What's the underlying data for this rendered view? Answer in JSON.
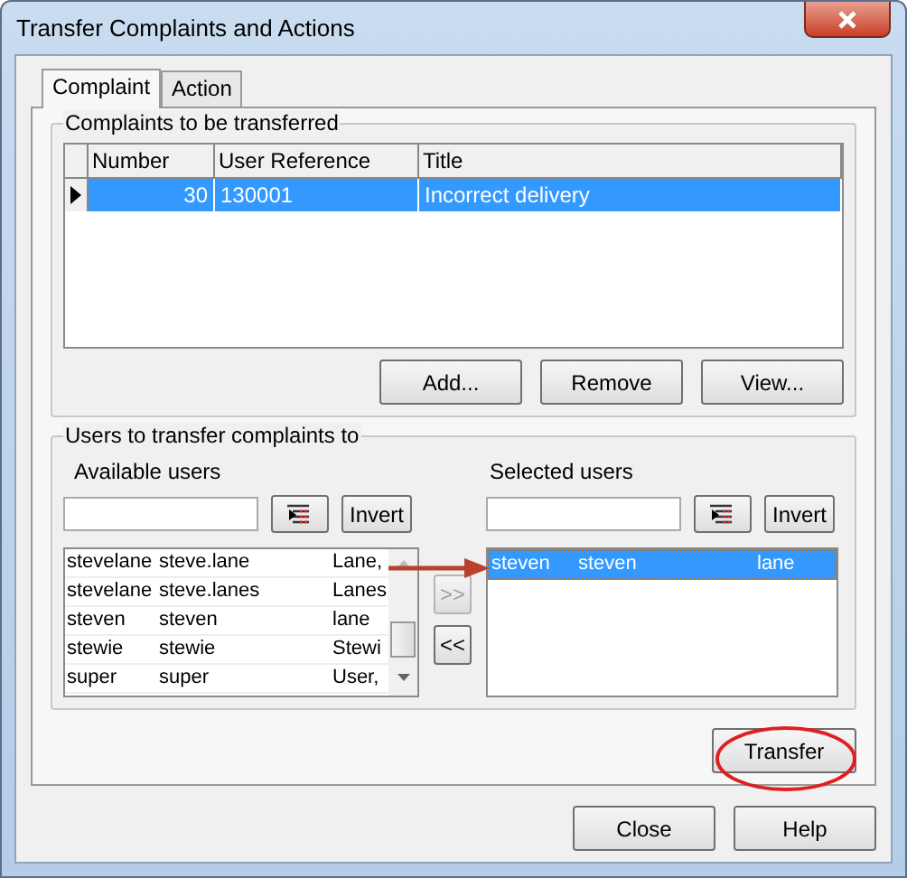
{
  "window": {
    "title": "Transfer Complaints and Actions"
  },
  "tabs": [
    {
      "label": "Complaint",
      "selected": true
    },
    {
      "label": "Action",
      "selected": false
    }
  ],
  "complaints": {
    "title": "Complaints to be transferred",
    "columns": [
      "Number",
      "User Reference",
      "Title"
    ],
    "rows": [
      {
        "number": "30",
        "user_reference": "130001",
        "title": "Incorrect delivery",
        "selected": true
      }
    ],
    "buttons": [
      "Add...",
      "Remove",
      "View..."
    ]
  },
  "users": {
    "title": "Users to transfer complaints to",
    "available": {
      "label": "Available users",
      "invert": "Invert",
      "rows": [
        {
          "cells": [
            "stevelane",
            "steve.lane",
            "Lane,"
          ],
          "selected": false
        },
        {
          "cells": [
            "stevelane",
            "steve.lanes",
            "Lanes"
          ],
          "selected": false
        },
        {
          "cells": [
            "steven",
            "steven",
            "lane"
          ],
          "selected": false
        },
        {
          "cells": [
            "stewie",
            "stewie",
            "Stewi"
          ],
          "selected": false
        },
        {
          "cells": [
            "super",
            "super",
            "User,"
          ],
          "selected": false
        }
      ]
    },
    "add_button": {
      "label": ">>",
      "disabled": true
    },
    "remove_button": {
      "label": "<<",
      "disabled": false
    },
    "selected": {
      "label": "Selected users",
      "invert": "Invert",
      "rows": [
        {
          "cells": [
            "steven",
            "steven",
            "lane"
          ],
          "selected": true
        }
      ]
    }
  },
  "transfer_button": "Transfer",
  "buttons": [
    "Close",
    "Help"
  ]
}
